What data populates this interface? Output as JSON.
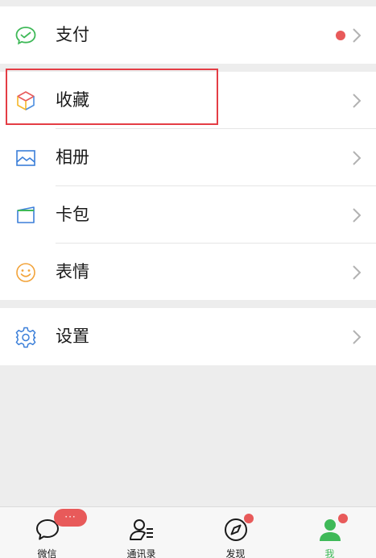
{
  "menu": {
    "pay": {
      "label": "支付",
      "icon": "wechat-pay-icon",
      "has_dot": true
    },
    "favorites": {
      "label": "收藏",
      "icon": "cube-icon"
    },
    "album": {
      "label": "相册",
      "icon": "image-icon"
    },
    "cards": {
      "label": "卡包",
      "icon": "wallet-card-icon"
    },
    "stickers": {
      "label": "表情",
      "icon": "smiley-icon"
    },
    "settings": {
      "label": "设置",
      "icon": "gear-icon"
    }
  },
  "tabbar": {
    "chats": {
      "label": "微信",
      "badge": "···",
      "icon": "chat-bubble-icon"
    },
    "contacts": {
      "label": "通讯录",
      "icon": "contacts-icon"
    },
    "discover": {
      "label": "发现",
      "icon": "compass-icon",
      "has_dot": true
    },
    "me": {
      "label": "我",
      "icon": "person-icon",
      "active": true,
      "has_dot": true
    }
  },
  "colors": {
    "accent_green": "#3fb958",
    "badge_red": "#e85a5a",
    "highlight_red": "#e43d45"
  }
}
